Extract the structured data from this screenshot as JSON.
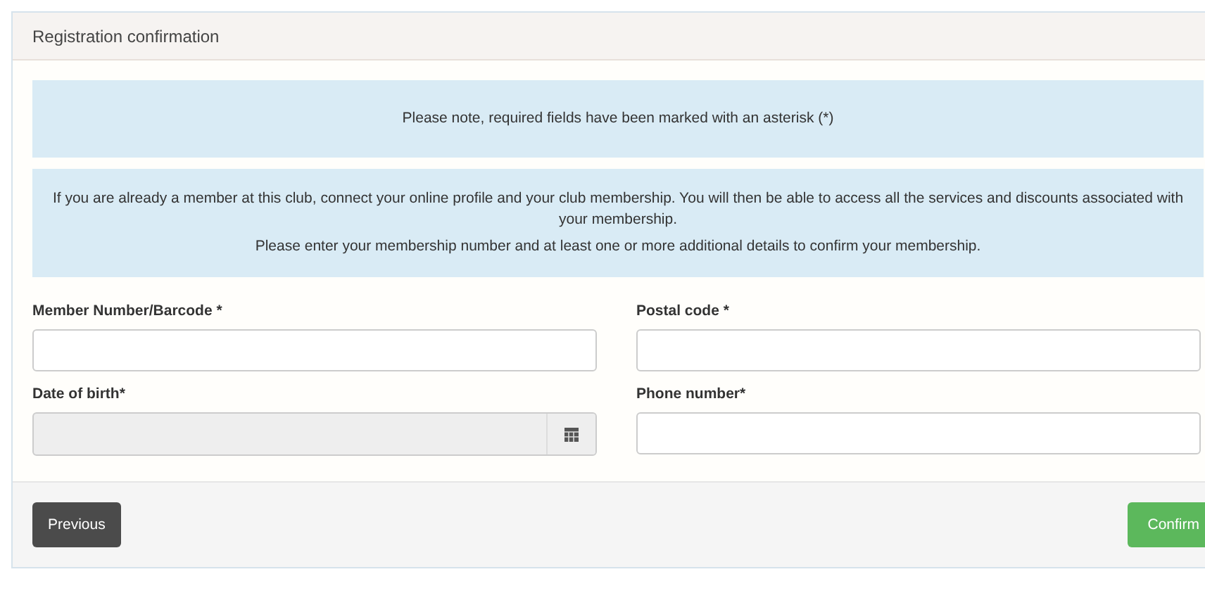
{
  "panel": {
    "title": "Registration confirmation"
  },
  "notices": [
    {
      "lines": [
        "Please note, required fields have been marked with an asterisk (*)"
      ]
    },
    {
      "lines": [
        "If you are already a member at this club, connect your online profile and your club membership. You will then be able to access all the services and discounts associated with your membership.",
        "Please enter your membership number and at least one or more additional details to confirm your membership."
      ]
    }
  ],
  "fields": [
    {
      "label": "Member Number/Barcode *",
      "kind": "text",
      "disabled": false
    },
    {
      "label": "Postal code *",
      "kind": "text",
      "disabled": false
    },
    {
      "label": "Date of birth*",
      "kind": "date",
      "disabled": true
    },
    {
      "label": "Phone number*",
      "kind": "text",
      "disabled": false
    }
  ],
  "buttons": [
    {
      "label": "Previous",
      "kind": "secondary"
    },
    {
      "label": "Confirm",
      "kind": "primary"
    }
  ]
}
